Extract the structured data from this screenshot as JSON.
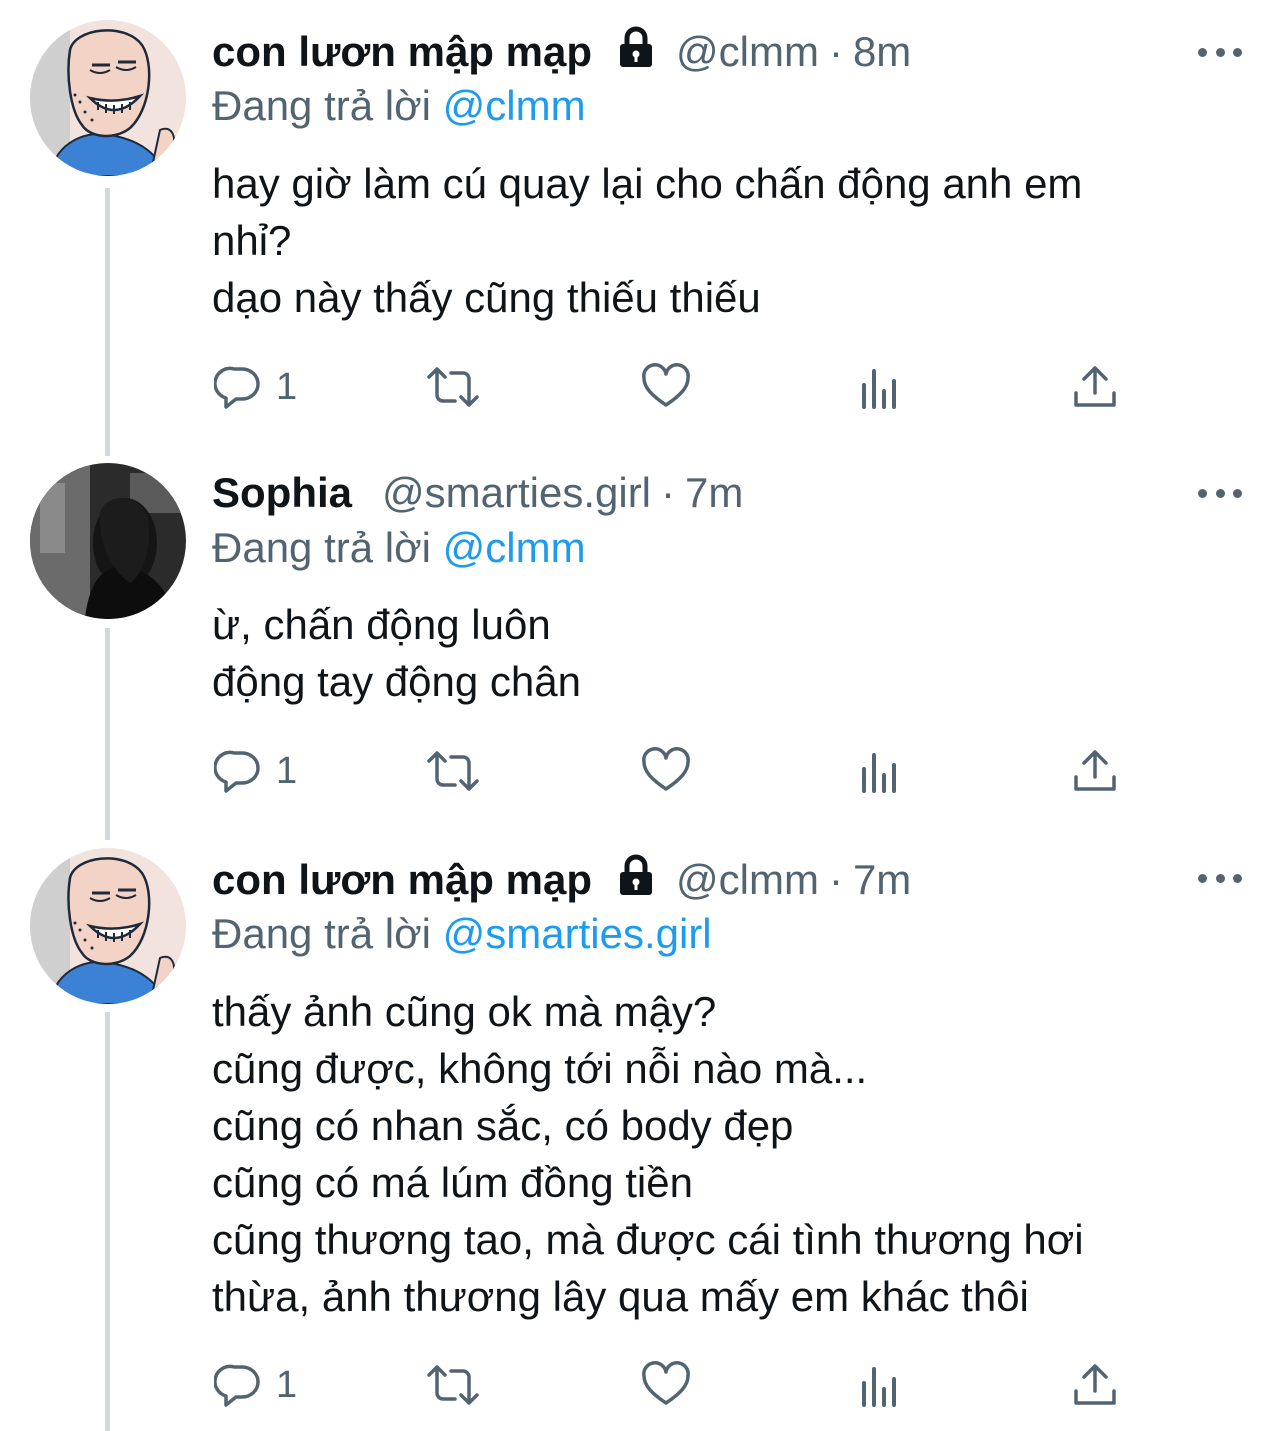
{
  "tweets": [
    {
      "name": "con lươn mập mạp",
      "locked": true,
      "handle": "@clmm",
      "time": "8m",
      "replying_prefix": "Đang trả lời",
      "replying_to": "@clmm",
      "body_lines": [
        "hay giờ làm cú quay lại cho chấn động anh em",
        "nhỉ?",
        "dạo này thấy cũng thiếu thiếu"
      ],
      "reply_count": "1"
    },
    {
      "name": "Sophia",
      "locked": false,
      "handle": "@smarties.girl",
      "time": "7m",
      "replying_prefix": "Đang trả lời",
      "replying_to": "@clmm",
      "body_lines": [
        "ừ, chấn động luôn",
        "động tay động chân"
      ],
      "reply_count": "1"
    },
    {
      "name": "con lươn mập mạp",
      "locked": true,
      "handle": "@clmm",
      "time": "7m",
      "replying_prefix": "Đang trả lời",
      "replying_to": "@smarties.girl",
      "body_lines": [
        "thấy ảnh cũng ok mà mậy?",
        "cũng được, không tới nỗi nào mà...",
        "cũng có nhan sắc, có body đẹp",
        "cũng có má lúm đồng tiền",
        "cũng thương tao, mà được cái tình thương hơi",
        "thừa, ảnh thương lây qua mấy em khác thôi"
      ],
      "reply_count": "1"
    }
  ],
  "separator": "·",
  "icons": [
    "lock-icon",
    "more-icon",
    "reply-icon",
    "retweet-icon",
    "like-icon",
    "analytics-icon",
    "share-icon"
  ],
  "colors": {
    "link": "#1d9bf0",
    "secondary": "#536471",
    "thread_line": "#cfd9de"
  }
}
